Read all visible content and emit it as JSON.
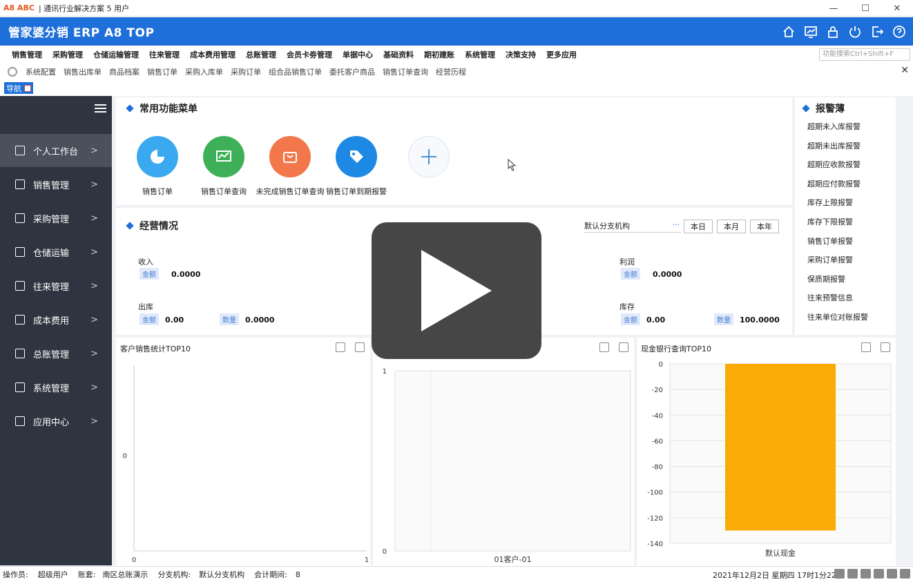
{
  "window": {
    "logo": "A8 ABC",
    "title": "| 通讯行业解决方案 5 用户"
  },
  "header": {
    "brand": "管家婆分销 ERP A8 TOP"
  },
  "menu": {
    "items": [
      "销售管理",
      "采购管理",
      "仓储运输管理",
      "往来管理",
      "成本费用管理",
      "总账管理",
      "会员卡劵管理",
      "单据中心",
      "基础资料",
      "期初建账",
      "系统管理",
      "决策支持",
      "更多应用"
    ],
    "search_placeholder": "功能搜索Ctrl+Shift+F"
  },
  "tabs": [
    "系统配置",
    "销售出库单",
    "商品档案",
    "销售订单",
    "采购入库单",
    "采购订单",
    "组合品销售订单",
    "委托客户商品",
    "销售订单查询",
    "经营历程"
  ],
  "nav_chip": "导航",
  "sidebar": {
    "items": [
      "个人工作台",
      "销售管理",
      "采购管理",
      "仓储运输",
      "往来管理",
      "成本费用",
      "总账管理",
      "系统管理",
      "应用中心"
    ]
  },
  "common_funcs": {
    "title": "常用功能菜单",
    "items": [
      {
        "label": "销售订单",
        "color": "#3aa9f0"
      },
      {
        "label": "销售订单查询",
        "color": "#3fb05a"
      },
      {
        "label": "未完成销售订单查询",
        "color": "#f2774b"
      },
      {
        "label": "销售订单到期报警",
        "color": "#1e88e5"
      }
    ]
  },
  "business": {
    "title": "经营情况",
    "org": "默认分支机构",
    "org_more": "···",
    "periods": [
      "本日",
      "本月",
      "本年"
    ],
    "income_label": "收入",
    "income_amount_tag": "金额",
    "income_amount": "0.0000",
    "mid_amount": "000",
    "profit_label": "利润",
    "profit_amount_tag": "金额",
    "profit_amount": "0.0000",
    "out_label": "出库",
    "out_amount_tag": "金额",
    "out_amount": "0.00",
    "out_qty_tag": "数量",
    "out_qty": "0.0000",
    "stock_label": "库存",
    "stock_amount_tag": "金额",
    "stock_amount": "0.00",
    "stock_qty_tag": "数量",
    "stock_qty": "100.0000"
  },
  "warnings": {
    "title": "报警薄",
    "items": [
      "超期未入库报警",
      "超期未出库报警",
      "超期应收款报警",
      "超期应付款报警",
      "库存上限报警",
      "库存下限报警",
      "销售订单报警",
      "采购订单报警",
      "保质期报警",
      "往来预警信息",
      "往来单位对账报警"
    ]
  },
  "charts": {
    "left_title": "客户销售统计TOP10",
    "right_title": "现金银行查询TOP10"
  },
  "chart_data": [
    {
      "type": "bar",
      "title": "客户销售统计TOP10",
      "categories": [],
      "values": [],
      "y_ticks": [
        "0"
      ],
      "x_ticks": [
        "0",
        "1"
      ]
    },
    {
      "type": "bar",
      "title": "",
      "categories": [
        "01客户-01"
      ],
      "values": [
        0
      ],
      "y_ticks": [
        "1",
        "0"
      ],
      "ylim": [
        0,
        1
      ]
    },
    {
      "type": "bar",
      "title": "现金银行查询TOP10",
      "categories": [
        "默认现金"
      ],
      "values": [
        -130
      ],
      "ylim": [
        -140,
        0
      ],
      "y_ticks": [
        "0",
        "-20",
        "-40",
        "-60",
        "-80",
        "-100",
        "-120",
        "-140"
      ],
      "bar_color": "#fbab06"
    }
  ],
  "status": {
    "operator_label": "操作员:",
    "operator": "超级用户",
    "account_label": "账套:",
    "account": "南区总账演示",
    "branch_label": "分支机构:",
    "branch": "默认分支机构",
    "period_label": "会计期间:",
    "period": "8",
    "datetime": "2021年12月2日  星期四  17时1分22秒"
  }
}
